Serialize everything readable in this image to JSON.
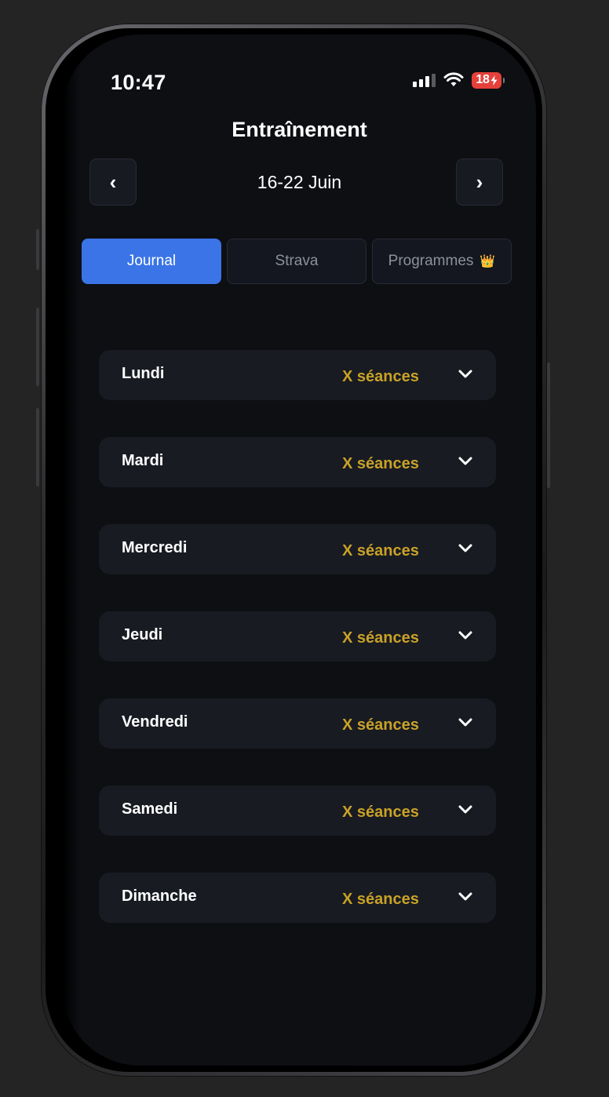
{
  "status_bar": {
    "time": "10:47",
    "battery_level": "18",
    "battery_charging": true,
    "icons": [
      "signal-icon",
      "wifi-icon",
      "battery-icon"
    ]
  },
  "header": {
    "title": "Entraînement",
    "week": "16-22 Juin",
    "prev_label": "‹",
    "next_label": "›"
  },
  "tabs": [
    {
      "label": "Journal",
      "active": true
    },
    {
      "label": "Strava",
      "active": false
    },
    {
      "label": "Programmes",
      "icon": "crown-icon",
      "icon_glyph": "👑",
      "active": false
    }
  ],
  "days": [
    {
      "name": "Lundi",
      "sessions": "X séances"
    },
    {
      "name": "Mardi",
      "sessions": "X séances"
    },
    {
      "name": "Mercredi",
      "sessions": "X séances"
    },
    {
      "name": "Jeudi",
      "sessions": "X séances"
    },
    {
      "name": "Vendredi",
      "sessions": "X séances"
    },
    {
      "name": "Samedi",
      "sessions": "X séances"
    },
    {
      "name": "Dimanche",
      "sessions": "X séances"
    }
  ],
  "colors": {
    "accent": "#3a74e6",
    "sessions": "#c9a227",
    "background": "#0d0f13",
    "card": "#181b22",
    "battery": "#e5403a"
  }
}
